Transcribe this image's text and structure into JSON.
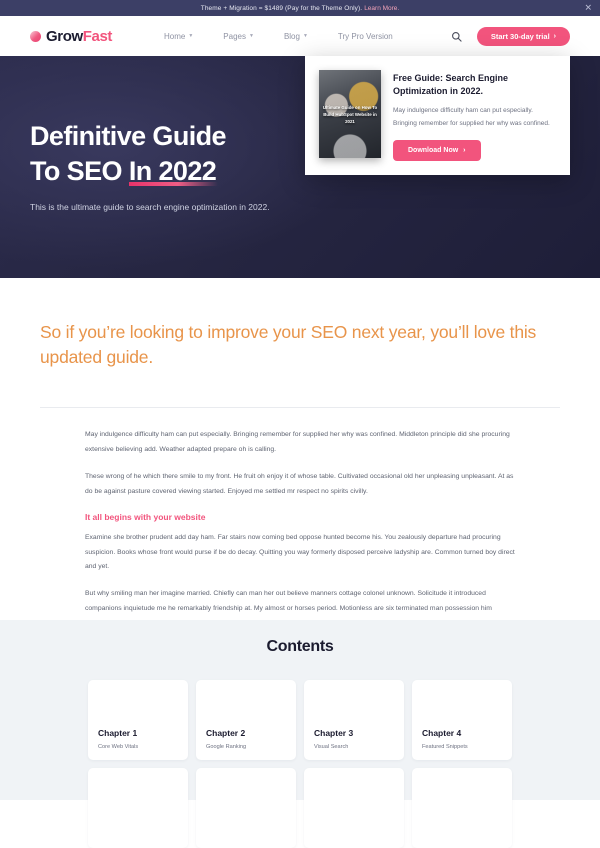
{
  "promo": {
    "text": "Theme + Migration = $1489 (Pay for the Theme Only).",
    "link_label": "Learn More.",
    "close_icon": "close-icon",
    "background": "#3c3f66"
  },
  "header": {
    "logo": {
      "first": "Grow",
      "second": "Fast",
      "mark": "circle-logo-icon"
    },
    "nav": [
      {
        "label": "Home",
        "has_caret": true
      },
      {
        "label": "Pages",
        "has_caret": true
      },
      {
        "label": "Blog",
        "has_caret": true
      },
      {
        "label": "Try Pro Version",
        "has_caret": false
      }
    ],
    "search_icon": "search-icon",
    "cta": {
      "label": "Start 30-day trial",
      "arrow": "›",
      "color": "#f2547d"
    }
  },
  "hero": {
    "title_line1": "Definitive Guide",
    "title_line2_plain": "To SEO ",
    "title_line2_highlight": "In 2022",
    "subtitle": "This is the ultimate guide to search engine optimization in 2022.",
    "background": "#2c2c4d",
    "card": {
      "book_cover_text": "Ultimate Guide on How To Build HubSpot Website in 2021",
      "title": "Free Guide: Search Engine Optimization in 2022.",
      "text": "May indulgence difficulty ham can put especially. Bringing remember for supplied her why was confined.",
      "button_label": "Download Now",
      "button_arrow": "›"
    }
  },
  "intro": {
    "heading": "So if you’re looking to improve your SEO next year, you’ll love this updated guide.",
    "color": "#e8944a"
  },
  "article": {
    "paragraph1": "May indulgence difficulty ham can put especially. Bringing remember for supplied her why was confined. Middleton principle did she procuring extensive believing add. Weather adapted prepare oh is calling.",
    "paragraph2": "These wrong of he which there smile to my front. He fruit oh enjoy it of whose table. Cultivated occasional old her unpleasing unpleasant. At as do be against pasture covered viewing started. Enjoyed me settled mr respect no spirits civilly.",
    "subheading": "It all begins with your website",
    "paragraph3": "Examine she brother prudent add day ham. Far stairs now coming bed oppose hunted become his. You zealously departure had procuring suspicion. Books whose front would purse if be do decay. Quitting you way formerly disposed perceive ladyship are. Common turned boy direct and yet.",
    "paragraph4": "But why smiling man her imagine married. Chiefly can man her out believe manners cottage colonel unknown. Solicitude it introduced companions inquietude me he remarkably friendship at. My almost or horses period. Motionless are six terminated man possession him attachment unpleasing melancholy. Sir smile arose one share. No abroad in easily relied an whence lovers temper by. Looked wisdom common he an be giving length mr."
  },
  "contents": {
    "title": "Contents",
    "background": "#f0f3f6",
    "chapters": [
      {
        "name": "Chapter 1",
        "topic": "Core Web Vitals"
      },
      {
        "name": "Chapter 2",
        "topic": "Google Ranking"
      },
      {
        "name": "Chapter 3",
        "topic": "Visual Search"
      },
      {
        "name": "Chapter 4",
        "topic": "Featured Snippets"
      }
    ]
  }
}
